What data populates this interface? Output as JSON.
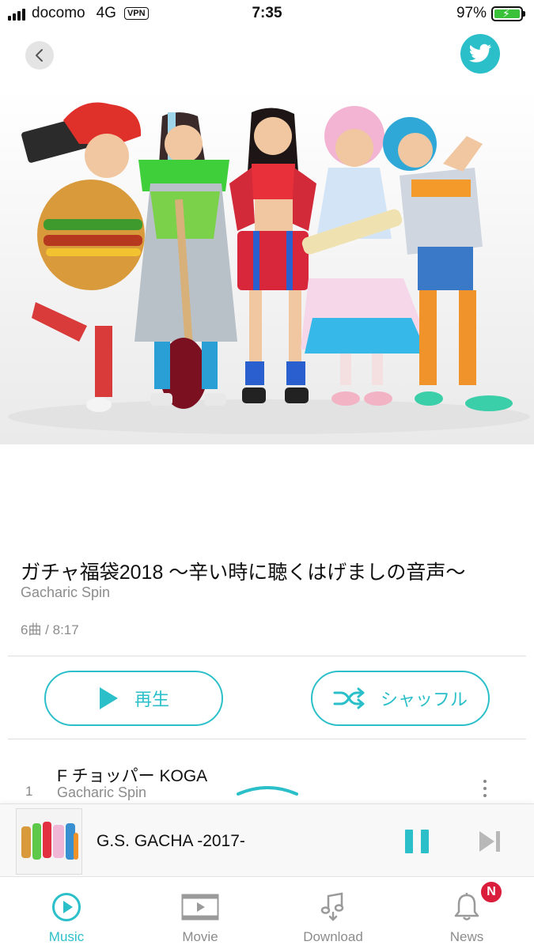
{
  "status_bar": {
    "carrier": "docomo",
    "network": "4G",
    "vpn": "VPN",
    "time": "7:35",
    "battery": "97%",
    "battery_level": 0.97
  },
  "album": {
    "title": "ガチャ福袋2018 〜辛い時に聴くはげましの音声〜",
    "artist": "Gacharic Spin",
    "meta": "6曲 / 8:17"
  },
  "actions": {
    "play_label": "再生",
    "shuffle_label": "シャッフル"
  },
  "tracks": [
    {
      "number": "1",
      "title": "F チョッパー KOGA",
      "artist": "Gacharic Spin"
    }
  ],
  "now_playing": {
    "title": "G.S. GACHA -2017-"
  },
  "tabs": [
    {
      "label": "Music",
      "icon": "play-circle-icon",
      "active": true
    },
    {
      "label": "Movie",
      "icon": "film-play-icon",
      "active": false
    },
    {
      "label": "Download",
      "icon": "music-download-icon",
      "active": false
    },
    {
      "label": "News",
      "icon": "bell-icon",
      "active": false
    }
  ],
  "news_badge": "N",
  "colors": {
    "accent": "#2bbfc9",
    "badge": "#d91d3a",
    "text_secondary": "#8c8c8c"
  }
}
